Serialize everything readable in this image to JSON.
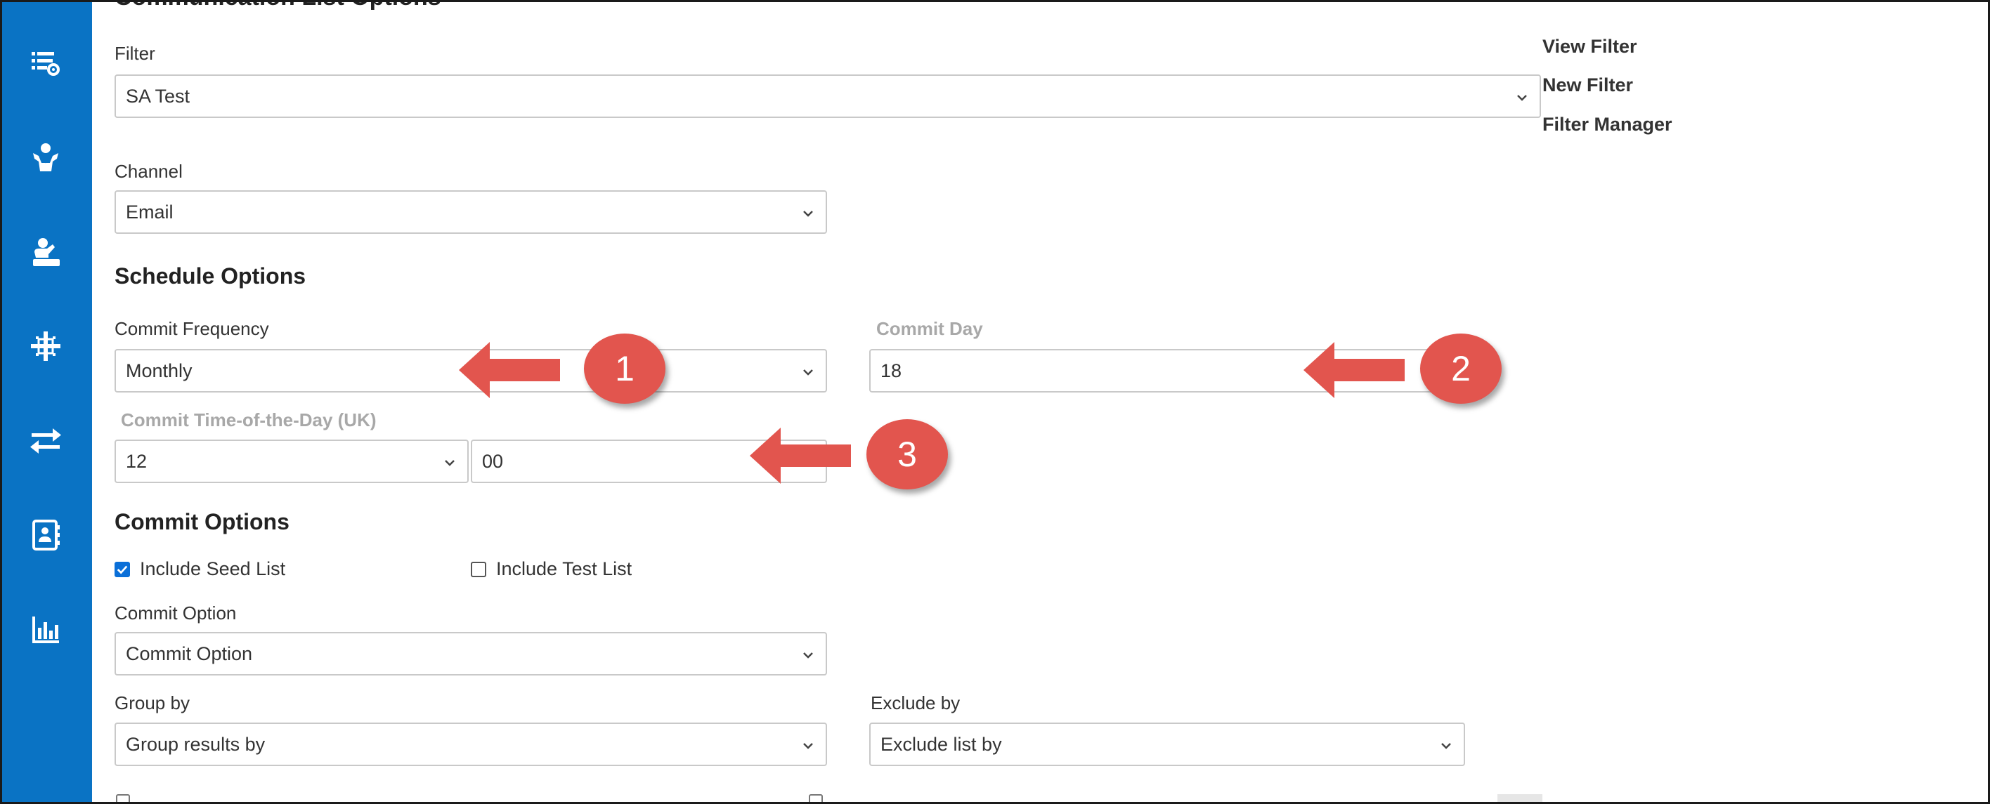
{
  "section": {
    "communication_list_title": "Communication List Options",
    "schedule_title": "Schedule Options",
    "commit_title": "Commit Options"
  },
  "filter": {
    "label": "Filter",
    "value": "SA Test",
    "links": {
      "view": "View Filter",
      "new": "New Filter",
      "manager": "Filter Manager"
    }
  },
  "channel": {
    "label": "Channel",
    "value": "Email"
  },
  "schedule": {
    "frequency_label": "Commit Frequency",
    "frequency_value": "Monthly",
    "day_label": "Commit Day",
    "day_value": "18",
    "time_label": "Commit Time-of-the-Day (UK)",
    "hour_value": "12",
    "minute_value": "00"
  },
  "commit": {
    "include_seed_label": "Include Seed List",
    "include_seed_checked": true,
    "include_test_label": "Include Test List",
    "include_test_checked": false,
    "option_label": "Commit Option",
    "option_value": "Commit Option",
    "group_label": "Group by",
    "group_value": "Group results by",
    "exclude_label": "Exclude by",
    "exclude_value": "Exclude list by"
  },
  "callouts": {
    "one": "1",
    "two": "2",
    "three": "3"
  },
  "colors": {
    "sidebar": "#0a73c4",
    "callout": "#e2554e",
    "checkbox": "#0a6fd8"
  },
  "sidebar_icons": [
    "list-settings-icon",
    "user-hands-icon",
    "user-desk-icon",
    "network-icon",
    "transfer-arrows-icon",
    "contact-card-icon",
    "bar-chart-icon"
  ]
}
